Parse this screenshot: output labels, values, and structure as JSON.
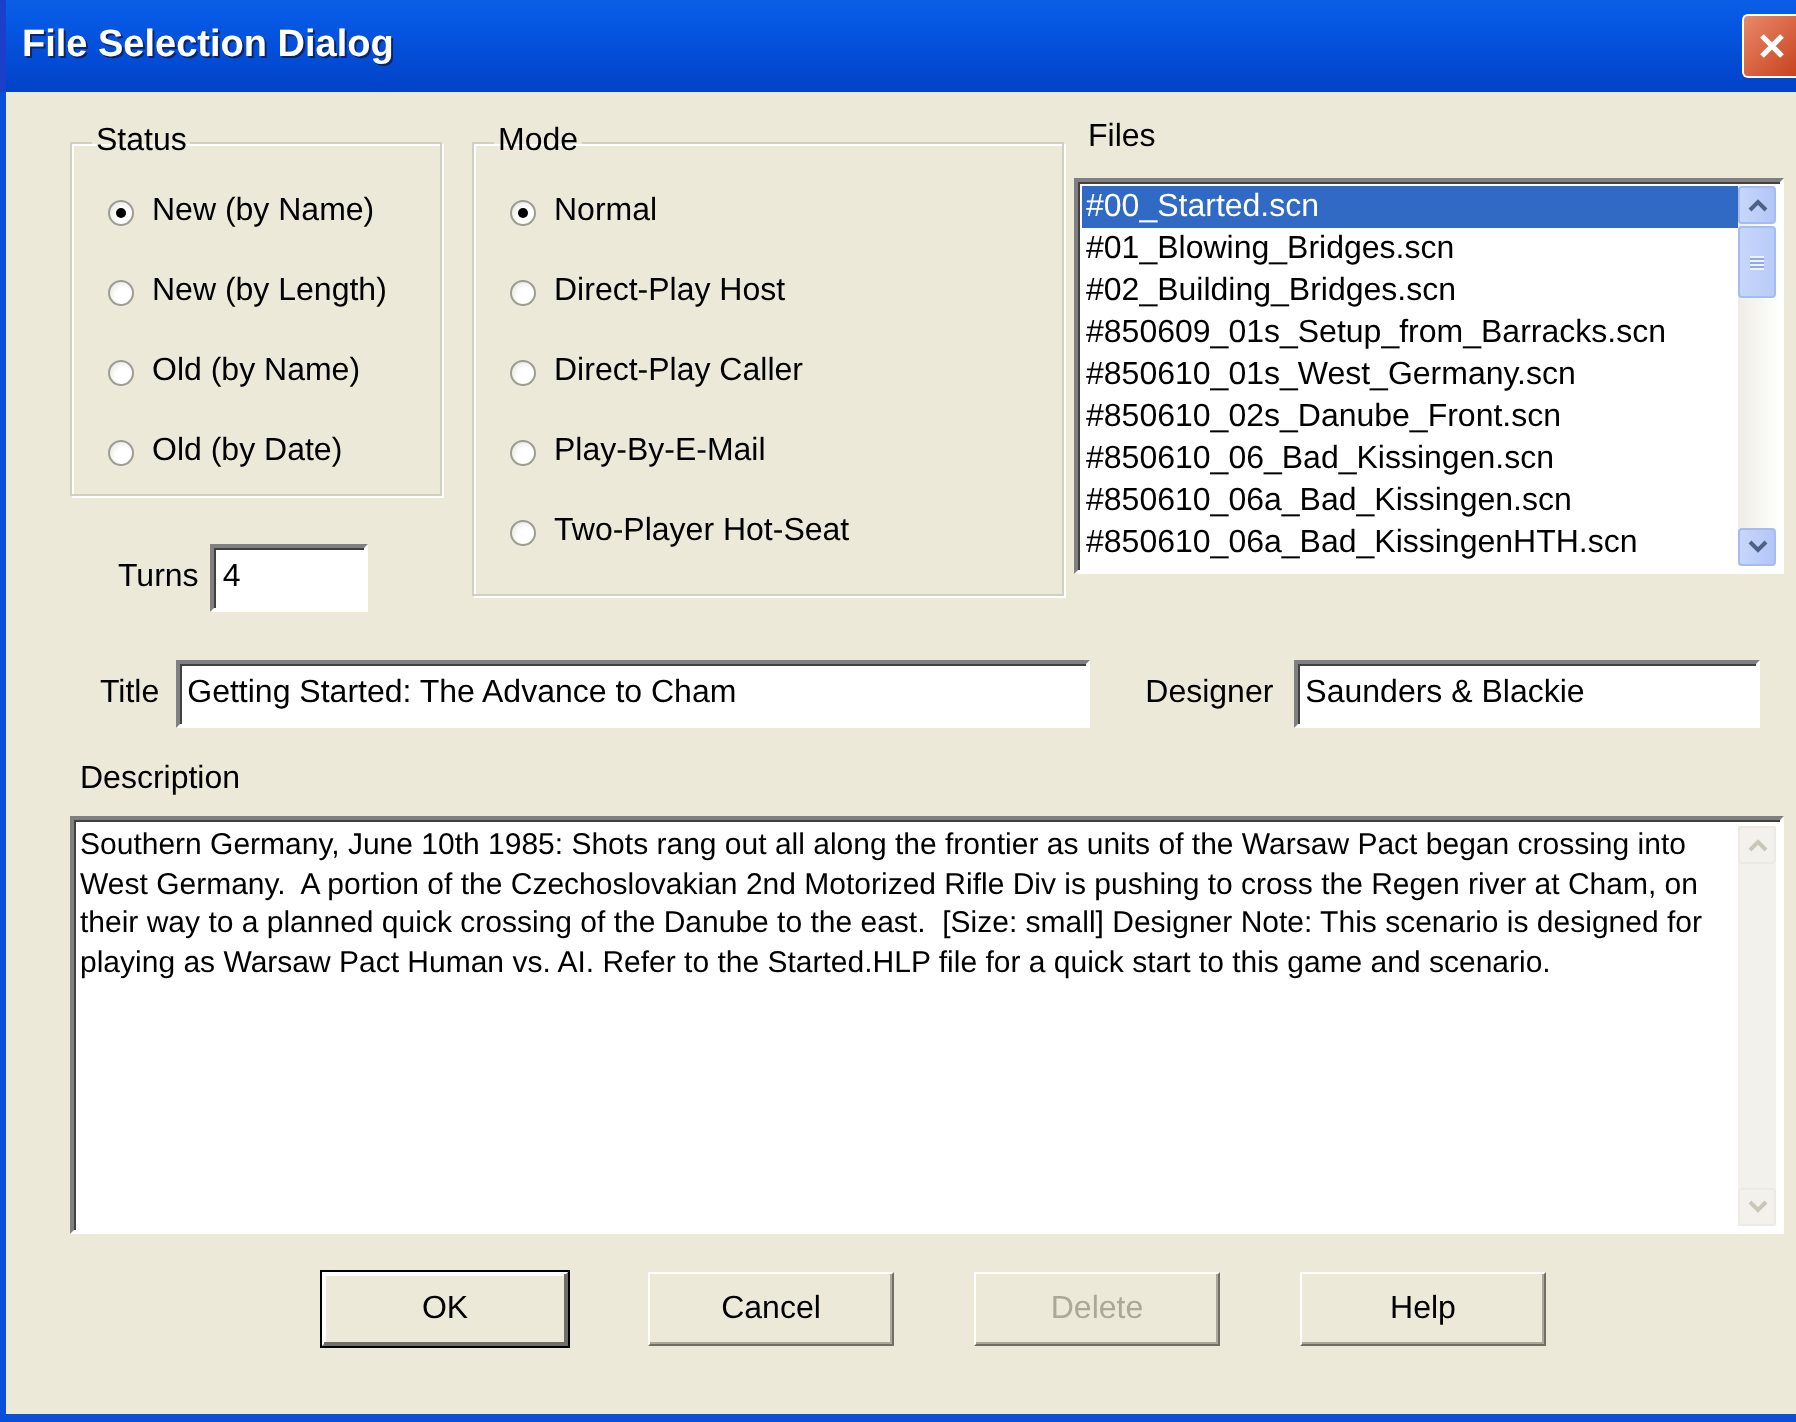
{
  "window": {
    "title": "File Selection Dialog"
  },
  "status": {
    "label": "Status",
    "options": [
      {
        "label": "New (by Name)",
        "selected": true
      },
      {
        "label": "New (by Length)",
        "selected": false
      },
      {
        "label": "Old (by Name)",
        "selected": false
      },
      {
        "label": "Old (by Date)",
        "selected": false
      }
    ]
  },
  "mode": {
    "label": "Mode",
    "options": [
      {
        "label": "Normal",
        "selected": true
      },
      {
        "label": "Direct-Play Host",
        "selected": false
      },
      {
        "label": "Direct-Play Caller",
        "selected": false
      },
      {
        "label": "Play-By-E-Mail",
        "selected": false
      },
      {
        "label": "Two-Player Hot-Seat",
        "selected": false
      }
    ]
  },
  "turns": {
    "label": "Turns",
    "value": "4"
  },
  "files": {
    "label": "Files",
    "items": [
      {
        "label": "#00_Started.scn",
        "selected": true
      },
      {
        "label": "#01_Blowing_Bridges.scn",
        "selected": false
      },
      {
        "label": "#02_Building_Bridges.scn",
        "selected": false
      },
      {
        "label": "#850609_01s_Setup_from_Barracks.scn",
        "selected": false
      },
      {
        "label": "#850610_01s_West_Germany.scn",
        "selected": false
      },
      {
        "label": "#850610_02s_Danube_Front.scn",
        "selected": false
      },
      {
        "label": "#850610_06_Bad_Kissingen.scn",
        "selected": false
      },
      {
        "label": "#850610_06a_Bad_Kissingen.scn",
        "selected": false
      },
      {
        "label": "#850610_06a_Bad_KissingenHTH.scn",
        "selected": false
      }
    ]
  },
  "title_field": {
    "label": "Title",
    "value": "Getting Started: The Advance to Cham"
  },
  "designer": {
    "label": "Designer",
    "value": "Saunders & Blackie"
  },
  "description": {
    "label": "Description",
    "value": "Southern Germany, June 10th 1985: Shots rang out all along the frontier as units of the Warsaw Pact began crossing into West Germany.  A portion of the Czechoslovakian 2nd Motorized Rifle Div is pushing to cross the Regen river at Cham, on their way to a planned quick crossing of the Danube to the east.  [Size: small] Designer Note: This scenario is designed for playing as Warsaw Pact Human vs. AI. Refer to the Started.HLP file for a quick start to this game and scenario."
  },
  "buttons": [
    {
      "label": "OK",
      "default": true,
      "disabled": false
    },
    {
      "label": "Cancel",
      "default": false,
      "disabled": false
    },
    {
      "label": "Delete",
      "default": false,
      "disabled": true
    },
    {
      "label": "Help",
      "default": false,
      "disabled": false
    }
  ]
}
